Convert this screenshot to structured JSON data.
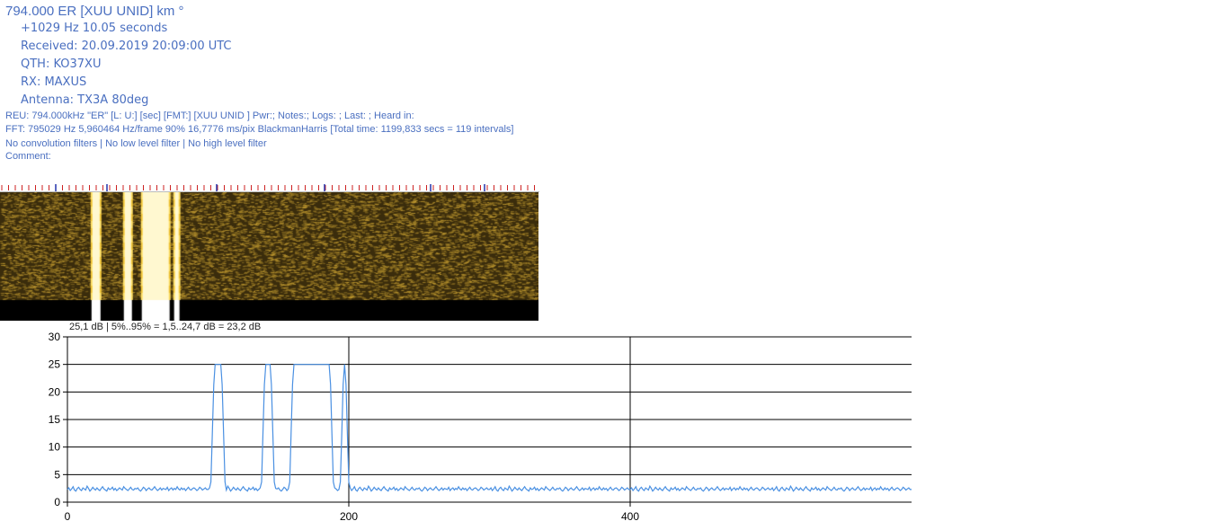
{
  "header": {
    "title": "794.000 ER [XUU UNID]  km °",
    "offset": "+1029 Hz 10.05 seconds",
    "received": "Received: 20.09.2019 20:09:00 UTC",
    "qth": "QTH: KO37XU",
    "rx": "RX: MAXUS",
    "antenna": "Antenna: TX3A 80deg",
    "reu": "REU: 794.000kHz \"ER\"  [L: U:] [sec] [FMT:] [XUU  UNID ] Pwr:; Notes:; Logs: ; Last: ; Heard in:",
    "fft": "FFT: 795029 Hz 5,960464 Hz/frame 90% 16,7776 ms/pix BlackmanHarris [Total time: 1199,833 secs = 119 intervals]",
    "filters": "No convolution filters | No low level filter | No high level filter",
    "comment": "Comment:"
  },
  "colors": {
    "text": "#4a6fc0",
    "line": "#4a90e2",
    "waterfall_bg": "#3a2c0c",
    "waterfall_speck": "#b8902a",
    "signal": "#ffd23a",
    "ruler_red": "#cc2222",
    "ruler_blue": "#2233aa"
  },
  "chart_data": {
    "type": "line",
    "stats_label": "25,1 dB | 5%..95% = 1,5..24,7 dB = 23,2 dB",
    "xlim": [
      0,
      600
    ],
    "ylim": [
      0,
      30
    ],
    "xticks": [
      0,
      200,
      400
    ],
    "yticks": [
      0,
      5,
      10,
      15,
      20,
      25,
      30
    ],
    "grid": true,
    "baseline_db": 2.3,
    "peaks": [
      {
        "start": 101,
        "end": 113,
        "level": 25
      },
      {
        "start": 137,
        "end": 148,
        "level": 25
      },
      {
        "start": 157,
        "end": 190,
        "level": 25
      },
      {
        "start": 193,
        "end": 201,
        "level": 25
      }
    ],
    "series": [
      {
        "values": [
          2.3,
          2.6,
          2.1,
          2.4,
          2.8,
          2.2,
          2.0,
          2.5,
          2.7,
          2.3,
          2.1,
          2.6,
          2.4,
          2.2,
          2.9,
          2.5,
          2.0,
          2.3,
          2.7,
          2.4,
          2.2,
          2.6,
          2.3,
          2.1,
          2.5,
          2.8,
          2.4,
          2.2,
          2.0,
          2.6,
          2.3,
          2.4,
          2.7,
          2.2,
          2.5,
          2.1,
          2.3,
          2.6,
          2.4,
          2.2,
          2.8,
          2.5,
          2.3,
          2.1,
          2.4,
          2.7,
          2.3,
          2.2,
          2.5,
          2.4,
          2.6,
          2.2,
          2.0,
          2.3,
          2.7,
          2.5,
          2.1,
          2.4,
          2.6,
          2.3,
          2.2,
          2.5,
          2.8,
          2.4,
          2.1,
          2.3,
          2.6,
          2.2,
          2.5,
          2.4,
          2.3,
          2.7,
          2.1,
          2.4,
          2.6,
          2.2,
          2.5,
          2.3,
          2.8,
          2.4,
          2.2,
          2.6,
          2.3,
          2.5,
          2.1,
          2.4,
          2.7,
          2.3,
          2.2,
          2.5,
          2.6,
          2.4,
          2.1,
          2.3,
          2.7,
          2.5,
          2.2,
          2.4,
          2.6,
          2.3
        ]
      }
    ]
  }
}
